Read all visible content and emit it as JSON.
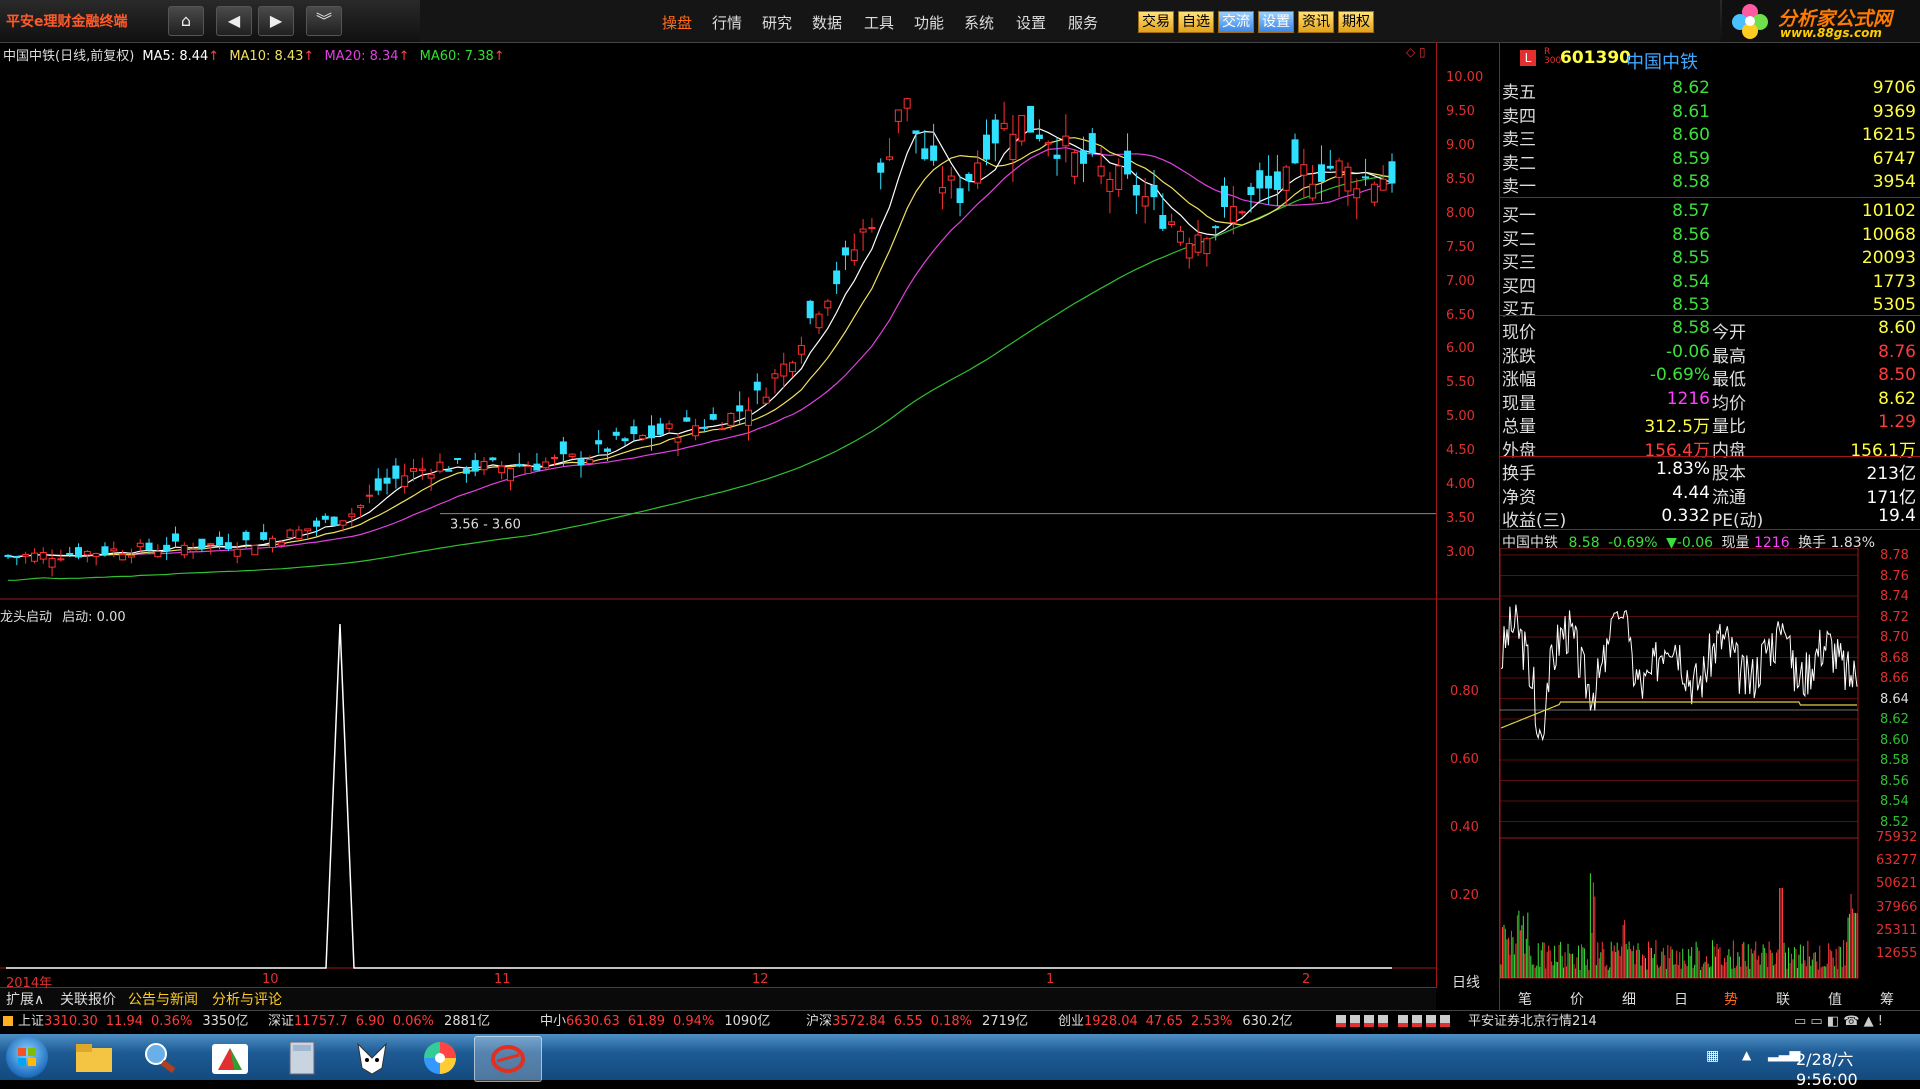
{
  "app": {
    "title": "平安e理财金融终端",
    "menu": [
      "操盘",
      "行情",
      "研究",
      "数据",
      "工具",
      "功能",
      "系统",
      "设置",
      "服务"
    ],
    "active_menu": "操盘",
    "quick_buttons": [
      "交易",
      "自选",
      "交流",
      "设置",
      "资讯",
      "期权"
    ],
    "brand_name": "分析家公式网",
    "brand_url": "www.88gs.com"
  },
  "chart": {
    "title": "中国中铁(日线,前复权)",
    "ma5_label": "MA5: 8.44",
    "ma10_label": "MA10: 8.43",
    "ma20_label": "MA20: 8.34",
    "ma60_label": "MA60: 7.38",
    "price_axis": [
      "10.00",
      "9.50",
      "9.00",
      "8.50",
      "8.00",
      "7.50",
      "7.00",
      "6.50",
      "6.00",
      "5.50",
      "5.00",
      "4.50",
      "4.00",
      "3.50",
      "3.00"
    ],
    "range_label": "3.56 - 3.60",
    "indicator_title": "龙头启动",
    "indicator_value": "启动: 0.00",
    "indicator_axis": [
      "0.80",
      "0.60",
      "0.40",
      "0.20"
    ],
    "time_axis": [
      "2014年",
      "10",
      "11",
      "12",
      "1",
      "2"
    ],
    "period": "日线",
    "colors": {
      "up": "#ff3030",
      "down": "#30e0ff",
      "ma5": "#ffffff",
      "ma10": "#f0e060",
      "ma20": "#e040e0",
      "ma60": "#30c030",
      "grid": "#a01818"
    }
  },
  "chart_data": {
    "type": "candlestick",
    "ylim": [
      3.0,
      10.0
    ],
    "closes_approx": [
      2.95,
      2.97,
      2.99,
      3.02,
      3.05,
      3.06,
      3.1,
      3.12,
      3.15,
      3.2,
      3.3,
      3.45,
      3.6,
      4.0,
      4.2,
      4.3,
      4.25,
      4.28,
      4.3,
      4.35,
      4.4,
      4.6,
      4.7,
      4.8,
      4.9,
      5.0,
      5.3,
      5.8,
      6.6,
      7.2,
      8.0,
      9.8,
      8.6,
      8.3,
      9.1,
      9.4,
      9.2,
      8.8,
      8.6,
      8.4,
      8.0,
      7.7,
      7.9,
      8.2,
      8.4,
      8.6,
      8.7,
      8.5,
      8.58
    ],
    "indicator_spike": {
      "date_label": "10",
      "value": 1.0
    }
  },
  "quote": {
    "code": "601390",
    "name": "中国中铁",
    "asks": [
      {
        "label": "卖五",
        "price": "8.62",
        "vol": "9706"
      },
      {
        "label": "卖四",
        "price": "8.61",
        "vol": "9369"
      },
      {
        "label": "卖三",
        "price": "8.60",
        "vol": "16215"
      },
      {
        "label": "卖二",
        "price": "8.59",
        "vol": "6747"
      },
      {
        "label": "卖一",
        "price": "8.58",
        "vol": "3954"
      }
    ],
    "bids": [
      {
        "label": "买一",
        "price": "8.57",
        "vol": "10102"
      },
      {
        "label": "买二",
        "price": "8.56",
        "vol": "10068"
      },
      {
        "label": "买三",
        "price": "8.55",
        "vol": "20093"
      },
      {
        "label": "买四",
        "price": "8.54",
        "vol": "1773"
      },
      {
        "label": "买五",
        "price": "8.53",
        "vol": "5305"
      }
    ],
    "stats": [
      {
        "l1": "现价",
        "v1": "8.58",
        "l2": "今开",
        "v2": "8.60"
      },
      {
        "l1": "涨跌",
        "v1": "-0.06",
        "l2": "最高",
        "v2": "8.76"
      },
      {
        "l1": "涨幅",
        "v1": "-0.69%",
        "l2": "最低",
        "v2": "8.50"
      },
      {
        "l1": "现量",
        "v1": "1216",
        "l2": "均价",
        "v2": "8.62"
      },
      {
        "l1": "总量",
        "v1": "312.5万",
        "l2": "量比",
        "v2": "1.29"
      },
      {
        "l1": "外盘",
        "v1": "156.4万",
        "l2": "内盘",
        "v2": "156.1万"
      }
    ],
    "stats2": [
      {
        "l1": "换手",
        "v1": "1.83%",
        "l2": "股本",
        "v2": "213亿"
      },
      {
        "l1": "净资",
        "v1": "4.44",
        "l2": "流通",
        "v2": "171亿"
      },
      {
        "l1": "收益(三)",
        "v1": "0.332",
        "l2": "PE(动)",
        "v2": "19.4"
      }
    ],
    "mini_header": {
      "name": "中国中铁",
      "price": "8.58",
      "pct": "-0.69%",
      "chg": "▼-0.06",
      "vol_label": "现量",
      "vol": "1216",
      "turn_label": "换手",
      "turn": "1.83%"
    },
    "mini_axis": [
      "8.78",
      "8.76",
      "8.74",
      "8.72",
      "8.70",
      "8.68",
      "8.66",
      "8.64",
      "8.62",
      "8.60",
      "8.58",
      "8.56",
      "8.54",
      "8.52"
    ],
    "mini_vol_axis": [
      "75932",
      "63277",
      "50621",
      "37966",
      "25311",
      "12655"
    ],
    "tabs": [
      "笔",
      "价",
      "细",
      "日",
      "势",
      "联",
      "值",
      "筹"
    ],
    "active_tab": "势"
  },
  "bottom_tabs": [
    "扩展∧",
    "关联报价",
    "公告与新闻",
    "分析与评论"
  ],
  "status": {
    "items": [
      {
        "name": "上证",
        "value": "3310.30",
        "chg": "11.94",
        "pct": "0.36%",
        "amt": "3350亿"
      },
      {
        "name": "深证",
        "value": "11757.7",
        "chg": "6.90",
        "pct": "0.06%",
        "amt": "2881亿"
      },
      {
        "name": "中小",
        "value": "6630.63",
        "chg": "61.89",
        "pct": "0.94%",
        "amt": "1090亿"
      },
      {
        "name": "沪深",
        "value": "3572.84",
        "chg": "6.55",
        "pct": "0.18%",
        "amt": "2719亿"
      },
      {
        "name": "创业",
        "value": "1928.04",
        "chg": "47.65",
        "pct": "2.53%",
        "amt": "630.2亿"
      }
    ],
    "server": "平安证券北京行情214"
  },
  "taskbar": {
    "clock": "2/28/六 9:56:00"
  }
}
